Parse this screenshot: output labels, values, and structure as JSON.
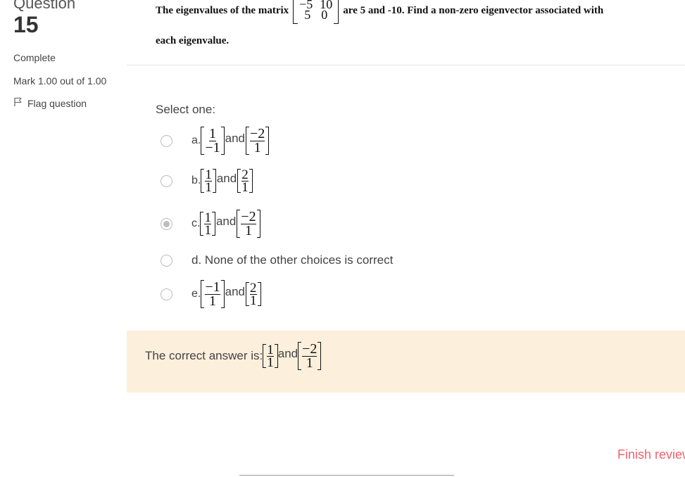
{
  "info": {
    "question_word": "Question",
    "question_number": "15",
    "state": "Complete",
    "grade": "Mark 1.00 out of 1.00",
    "flag_label": "Flag question"
  },
  "question": {
    "text_before": "The eigenvalues of the matrix",
    "matrix": [
      [
        "−5",
        "10"
      ],
      [
        "5",
        "0"
      ]
    ],
    "text_after": "are 5 and -10. Find a non-zero eigenvector associated with",
    "text_line2": "each eigenvalue."
  },
  "prompt": "Select one:",
  "and_word": "and",
  "options": [
    {
      "letter": "a.",
      "v1": [
        "1",
        "−1"
      ],
      "v2": [
        "−2",
        "1"
      ],
      "selected": false
    },
    {
      "letter": "b.",
      "v1": [
        "1",
        "1"
      ],
      "v2": [
        "2",
        "1"
      ],
      "selected": false
    },
    {
      "letter": "c.",
      "v1": [
        "1",
        "1"
      ],
      "v2": [
        "−2",
        "1"
      ],
      "selected": true
    },
    {
      "letter": "d.",
      "text": "None of the other choices is correct",
      "selected": false
    },
    {
      "letter": "e.",
      "v1": [
        "−1",
        "1"
      ],
      "v2": [
        "2",
        "1"
      ],
      "selected": false
    }
  ],
  "feedback": {
    "label": "The correct answer is:",
    "v1": [
      "1",
      "1"
    ],
    "v2": [
      "−2",
      "1"
    ]
  },
  "finish_link": "Finish review",
  "colors": {
    "feedback_bg": "#fcefdc",
    "finish_link": "#f0616c"
  }
}
